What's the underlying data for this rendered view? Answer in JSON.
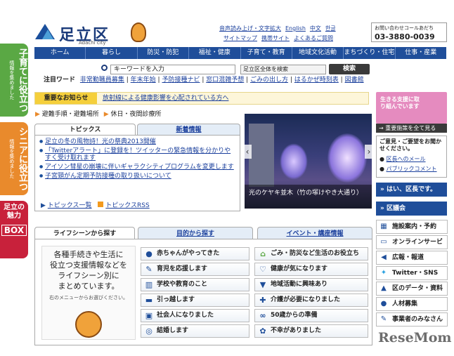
{
  "colors": {
    "primary": "#1f4e9a",
    "accent_green": "#5aa844",
    "accent_orange": "#e98a2c",
    "accent_red": "#c8213b",
    "accent_pink": "#e58bbf",
    "notice_yellow": "#f5cf3b"
  },
  "side_tabs": [
    {
      "title": "子育てに役立つ",
      "sub": "情報を集めました"
    },
    {
      "title": "シニアに役立つ",
      "sub": "情報を集めました"
    },
    {
      "title": "足立の魅力",
      "sub": "BOX"
    }
  ],
  "header": {
    "logo_text": "足立区",
    "logo_sub": "Adachi city",
    "util": [
      "音声読み上げ・文字拡大",
      "English",
      "中文",
      "한글"
    ],
    "util2": [
      "サイトマップ",
      "携帯サイト",
      "よくあるご質問"
    ],
    "call_title": "お問い合わせコールあだち",
    "call_number": "03-3880-0039"
  },
  "nav": [
    "ホーム",
    "暮らし",
    "防災・防犯",
    "福祉・健康",
    "子育て・教育",
    "地域文化活動",
    "まちづくり・住宅",
    "仕事・産業"
  ],
  "search": {
    "placeholder": "キーワードを入力",
    "scope": "足立区全体を検索",
    "button": "検索"
  },
  "attention": {
    "label": "注目ワード",
    "items": [
      "非常勤職員募集",
      "年末年始",
      "予防接種ナビ",
      "窓口混雑予想",
      "ごみの出し方",
      "はるかぜ時刻表",
      "図書館"
    ]
  },
  "notice": {
    "label": "重要なお知らせ",
    "text": "放射線による健康影響を心配されている方へ"
  },
  "quick_links": [
    "避難手順・避難場所",
    "休日・夜間診療所"
  ],
  "topics": {
    "tab_active": "トピックス",
    "tab_other": "新着情報",
    "items": [
      "足立の冬の風物詩！光の祭典2013開催",
      "「Twitterアラート」に登録を！ツイッターの緊急情報を分かりやすく受け取れます",
      "アイソン彗星の崩壊に伴いギャラクシティプログラムを変更します",
      "子宮頸がん定期予防接種の取り扱いについて"
    ],
    "more": "トピックス一覧",
    "rss": "トピックスRSS"
  },
  "photo_caption": "光のケヤキ並木（竹の塚けやき大通り）",
  "right": {
    "support_banner": "生きる支援に取り組んでいます",
    "support_link": "重要施策を全て見る",
    "opinion_title": "ご意見・ご要望をお聞かせください。",
    "opinion_links": [
      "区長へのメール",
      "パブリックコメント"
    ],
    "mayor": "はい、区長です。",
    "council": "区議会",
    "services": [
      "施設案内・予約",
      "オンラインサービス",
      "広報・報道",
      "Twitter・SNS",
      "区のデータ・資料",
      "人材募集",
      "事業者のみなさん"
    ]
  },
  "life": {
    "tabs": [
      "ライフシーンから探す",
      "目的から探す",
      "イベント・講座情報"
    ],
    "intro": [
      "各種手続きや生活に",
      "役立つ支援情報などを",
      "ライフシーン別に",
      "まとめています。"
    ],
    "intro_note": "右のメニューからお選びください。",
    "left": [
      "赤ちゃんがやってきた",
      "育児を応援します",
      "学校や教育のこと",
      "引っ越します",
      "社会人になりました",
      "結婚します"
    ],
    "right": [
      "ごみ・防災など生活のお役立ち",
      "健康が気になります",
      "地域活動に興味あり",
      "介護が必要になりました",
      "50歳からの準備",
      "不幸がありました"
    ]
  },
  "watermark": "ReseMom"
}
